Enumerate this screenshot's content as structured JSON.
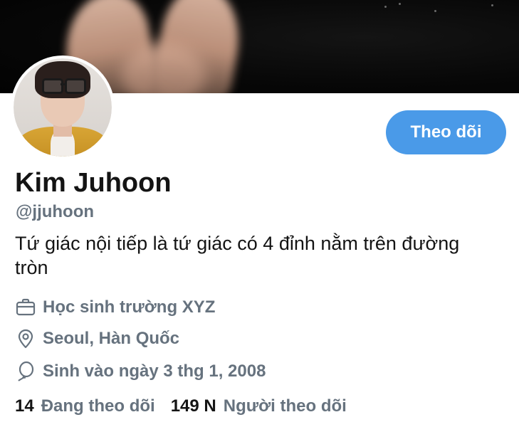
{
  "profile": {
    "name": "Kim Juhoon",
    "handle": "@jjuhoon",
    "bio": "Tứ giác nội tiếp là tứ giác có 4 đỉnh nằm trên đường tròn",
    "job": "Học sinh trường XYZ",
    "location": "Seoul, Hàn Quốc",
    "birthday": "Sinh vào ngày 3 thg 1, 2008"
  },
  "actions": {
    "follow_label": "Theo dõi"
  },
  "stats": {
    "following_count": "14",
    "following_label": "Đang theo dõi",
    "followers_count": "149 N",
    "followers_label": "Người theo dõi"
  },
  "icons": {
    "job": "briefcase-icon",
    "location": "location-pin-icon",
    "birthday": "balloon-icon"
  },
  "colors": {
    "accent": "#4a9ae8",
    "text_primary": "#141414",
    "text_secondary": "#66727e"
  }
}
